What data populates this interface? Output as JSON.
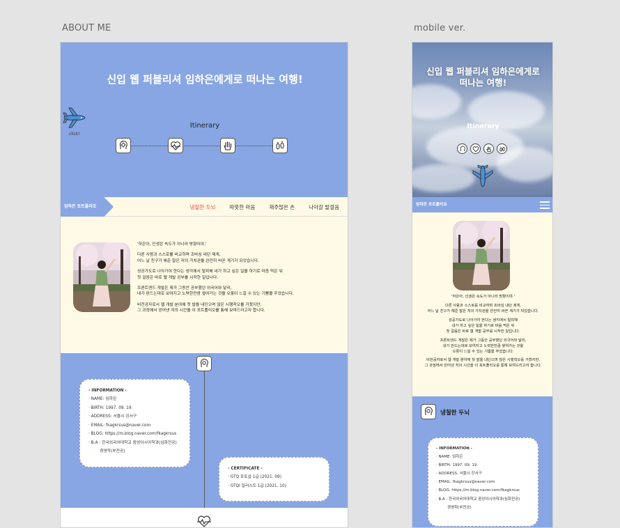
{
  "captions": {
    "desktop": "ABOUT ME",
    "mobile": "mobile ver."
  },
  "hero": {
    "title": "신입 웹 퍼블리셔 임하은에게로 떠나는 여행!",
    "mobile_title_line1": "신입 웹 퍼블리셔 임하은에게로",
    "mobile_title_line2": "떠나는 여행!",
    "click_label": "click!",
    "itinerary_label": "Itinerary",
    "itinerary_icons": [
      "brain-gear-icon",
      "heart-pulse-icon",
      "hand-icon",
      "footprints-icon"
    ]
  },
  "nav": {
    "brand": "임하은 포트폴리오",
    "items": [
      "냉철한 두뇌",
      "따뜻한 마음",
      "재주많은 손",
      "나아갈 발걸음"
    ],
    "active_index": 0
  },
  "about": {
    "paragraphs": [
      "'하은아, 인생은 속도가 아니라 방향이야.'",
      "다른 사람과 스스로를 비교하며 조바심 내던 제게,\n어느 날 친구가 해준 말은 저의 가치관을 완전히 바꾼 계기가 되었습니다.",
      "성공가도로 나아가야 한다는 생각에서 탈피해 내가 하고 싶은 일을 하기로 마음 먹은 뒤\n첫 걸음은 바로 웹 개발 공부를 시작한 일입니다.",
      "프론트엔드 개발은 제가 그동안 공부했던 외국어와 달리,\n내가 판드는대로 보여지고 노력한만큼 쌓여가는 것을 오롯이 느낄 수 있는 기쁨을 주었습니다.",
      "비전공자로서 웹 개발 분야에 첫 발을 내딘으며 많은 시행착오를 거쳤지만,\n그 과정에서 얻어낸 저의 시간을 이 포트폴리오를 통해 보여드리고자 합니다."
    ],
    "mobile_paragraphs": [
      "'하은아, 인생은 속도가 아니라 방향이야.'",
      "다른 사람과 스스로를 비교하며 조바심 내던 제게,\n어느 날 친구가 해준 말은 저의 가치관을 완전히 바꾼 계기가 되었습니다.",
      "성공가도로 나아가야 한다는 생각에서 탈피해\n내가 하고 싶은 일을 하기로 마음 먹은 뒤\n첫 걸음은 바로 웹 개발 공부를 시작한 일입니다.",
      "프론트엔드 개발은 제가 그동안 공부했던 외국어와 달리,\n내가 만드는대로 보여지고 노력한만큼 쌓여가는 것을\n오롯이 느낄 수 있는 기쁨을 주었습니다.",
      "비전공자로서 웹 개발 분야에 첫 발을 내딘으며 많은 시행착오를 거쳤지만,\n그 과정에서 얻어낸 저의 시간을 이 포트폴리오를 통해 보여드리고자 합니다."
    ]
  },
  "info": {
    "title": "- INFORMATION -",
    "lines": [
      "· NAME: 임하은",
      "· BIRTH: 1997. 09. 19.",
      "· ADDRESS: 서울시 강서구",
      "· EMAIL: fkagkrsus@naver.com",
      "· BLOG: https://m.blog.naver.com/fkagkrsus",
      "· B.A : 한국외국어대학교 중앙아시아학과(심화전공)",
      "경영학(부전공)"
    ]
  },
  "cert": {
    "title": "- CERTIFICATE -",
    "lines": [
      "· GTQ 포토샵 1급 (2021. 09)",
      "· GTQi 일러스트 1급 (2021. 10)"
    ]
  },
  "section": {
    "title": "냉철한 두뇌"
  },
  "colors": {
    "accent_blue": "#88a6e3",
    "cream": "#fffae6",
    "active_red": "#e74c3c"
  }
}
